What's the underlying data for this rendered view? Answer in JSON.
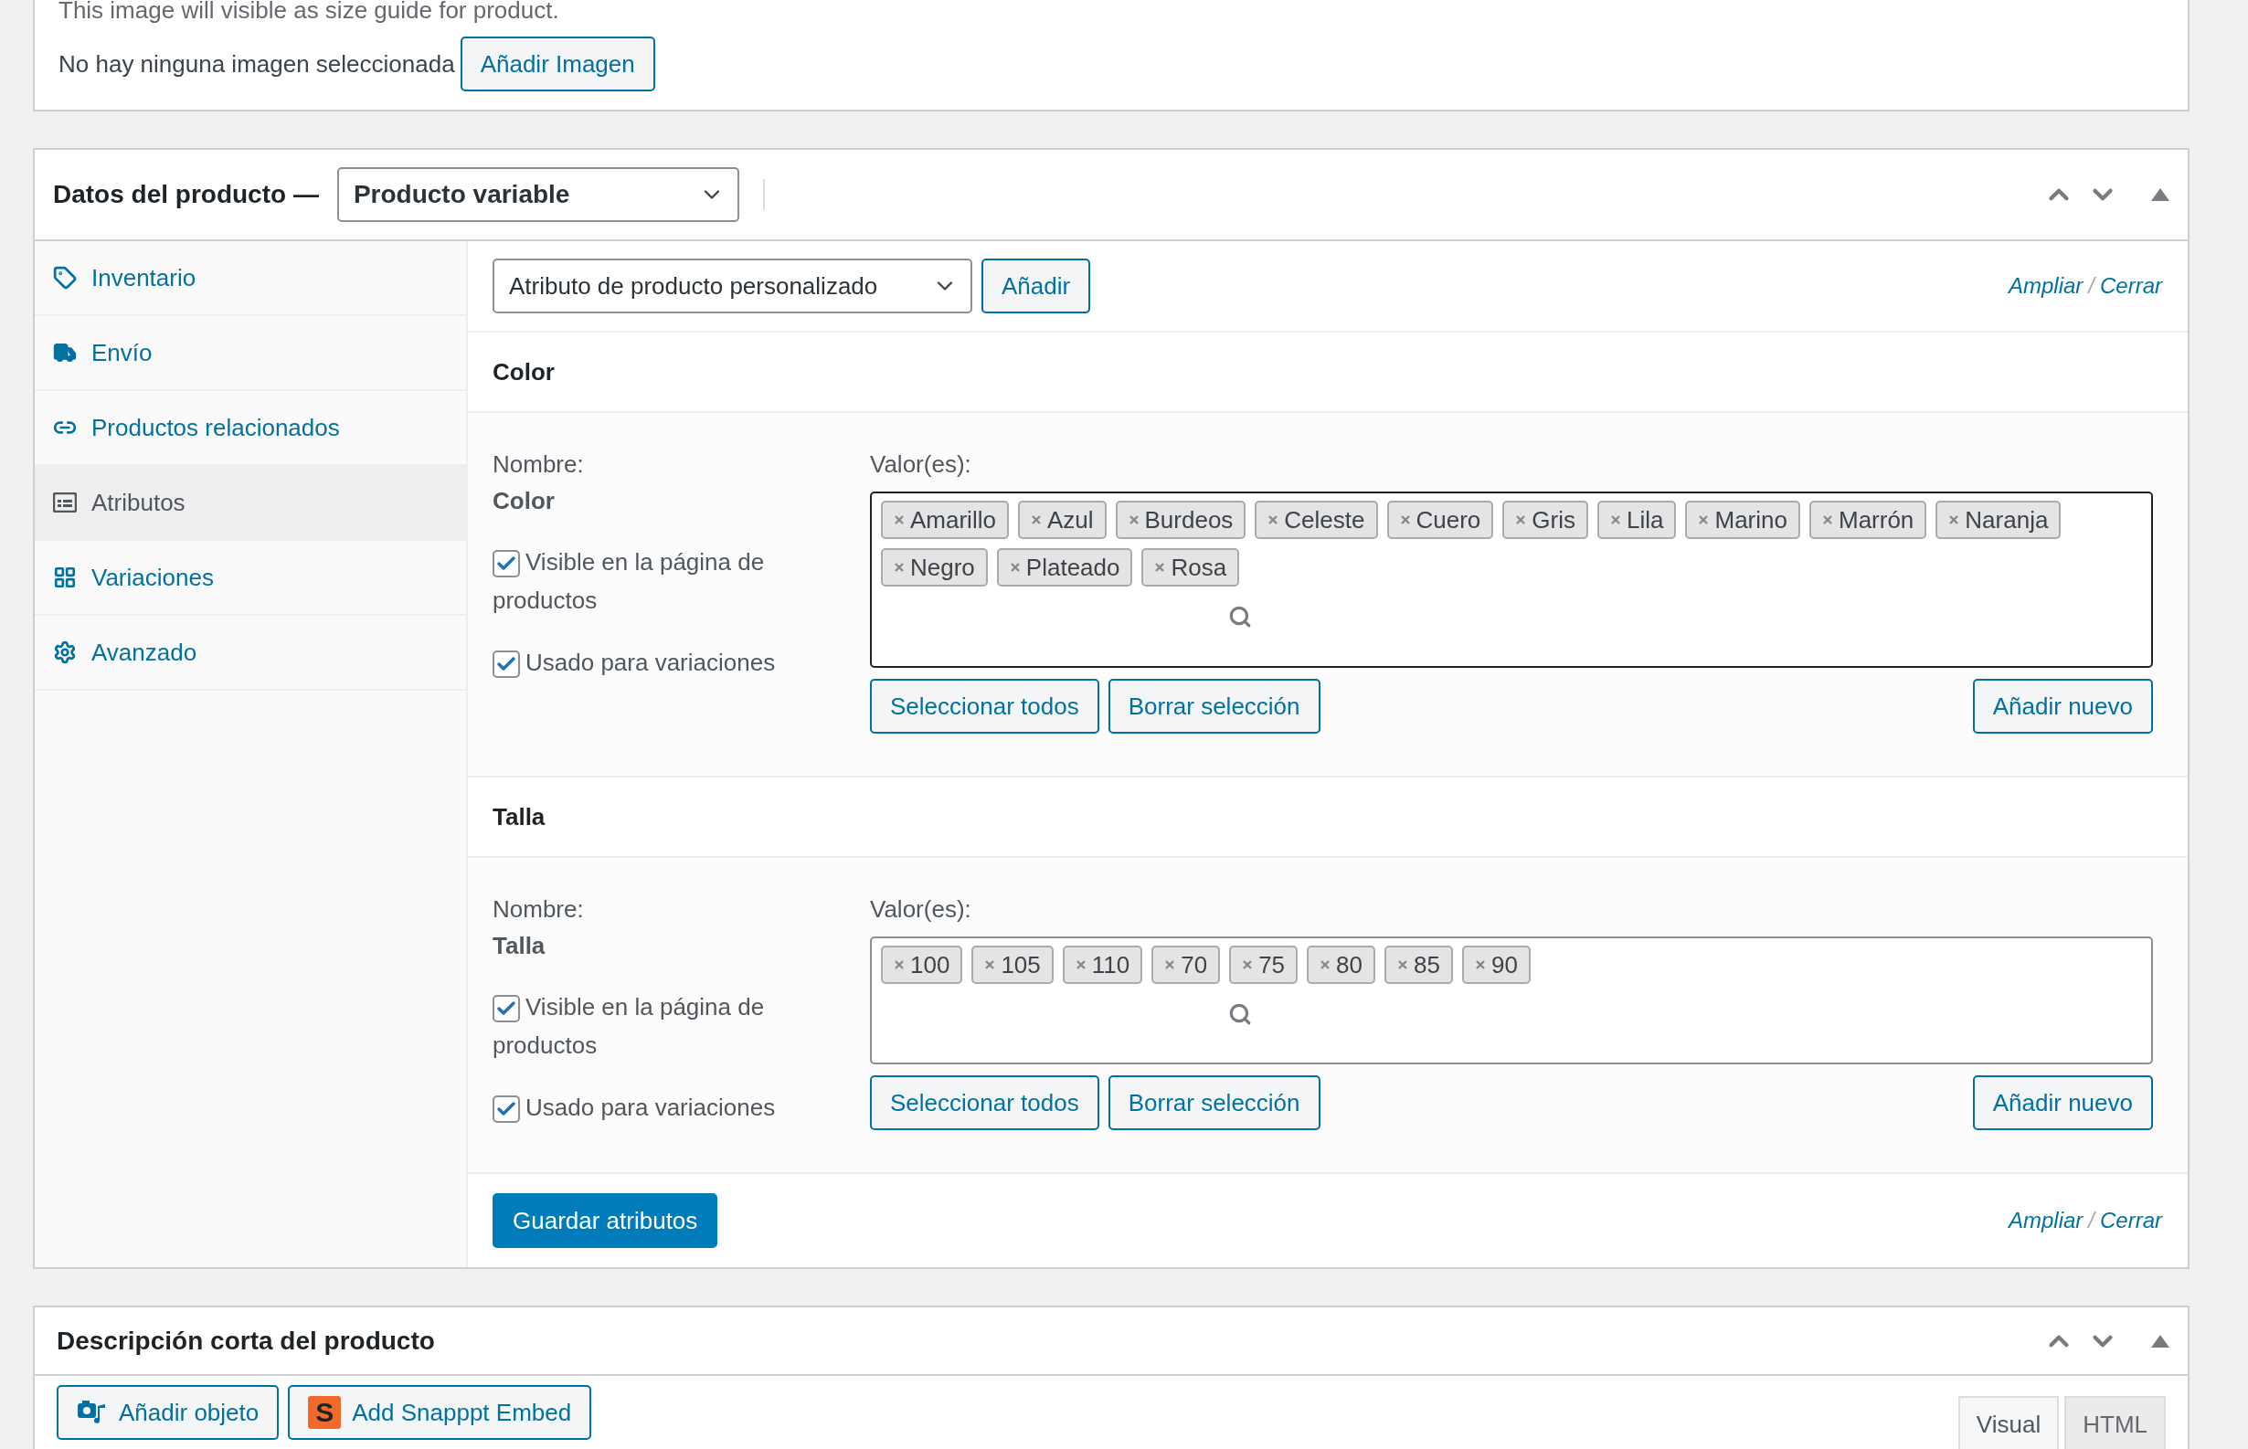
{
  "size_guide": {
    "description": "This image will visible as size guide for product.",
    "status": "No hay ninguna imagen seleccionada",
    "button": "Añadir Imagen"
  },
  "product_data": {
    "title": "Datos del producto —",
    "type_select": "Producto variable",
    "tabs": [
      {
        "label": "Inventario",
        "selected": false
      },
      {
        "label": "Envío",
        "selected": false
      },
      {
        "label": "Productos relacionados",
        "selected": false
      },
      {
        "label": "Atributos",
        "selected": true
      },
      {
        "label": "Variaciones",
        "selected": false
      },
      {
        "label": "Avanzado",
        "selected": false
      }
    ],
    "attribute_select": "Atributo de producto personalizado",
    "add_button": "Añadir",
    "top_links": {
      "expand": "Ampliar",
      "separator": "/",
      "close": "Cerrar"
    },
    "attributes": [
      {
        "title": "Color",
        "name_label": "Nombre:",
        "name": "Color",
        "values_label": "Valor(es):",
        "focused": true,
        "values": [
          "Amarillo",
          "Azul",
          "Burdeos",
          "Celeste",
          "Cuero",
          "Gris",
          "Lila",
          "Marino",
          "Marrón",
          "Naranja",
          "Negro",
          "Plateado",
          "Rosa"
        ],
        "options": [
          {
            "label": "Visible en la página de productos",
            "checked": true
          },
          {
            "label": "Usado para variaciones",
            "checked": true
          }
        ],
        "buttons": {
          "select_all": "Seleccionar todos",
          "clear": "Borrar selección",
          "add_new": "Añadir nuevo"
        }
      },
      {
        "title": "Talla",
        "name_label": "Nombre:",
        "name": "Talla",
        "values_label": "Valor(es):",
        "focused": false,
        "values": [
          "100",
          "105",
          "110",
          "70",
          "75",
          "80",
          "85",
          "90"
        ],
        "options": [
          {
            "label": "Visible en la página de productos",
            "checked": true
          },
          {
            "label": "Usado para variaciones",
            "checked": true
          }
        ],
        "buttons": {
          "select_all": "Seleccionar todos",
          "clear": "Borrar selección",
          "add_new": "Añadir nuevo"
        }
      }
    ],
    "save_button": "Guardar atributos",
    "bottom_links": {
      "expand": "Ampliar",
      "separator": "/",
      "close": "Cerrar"
    }
  },
  "short_description": {
    "title": "Descripción corta del producto",
    "buttons": [
      {
        "label": "Añadir objeto"
      },
      {
        "label": "Add Snapppt Embed",
        "badge": "S"
      }
    ],
    "tabs": [
      {
        "label": "Visual",
        "selected": true
      },
      {
        "label": "HTML",
        "selected": false
      }
    ]
  }
}
